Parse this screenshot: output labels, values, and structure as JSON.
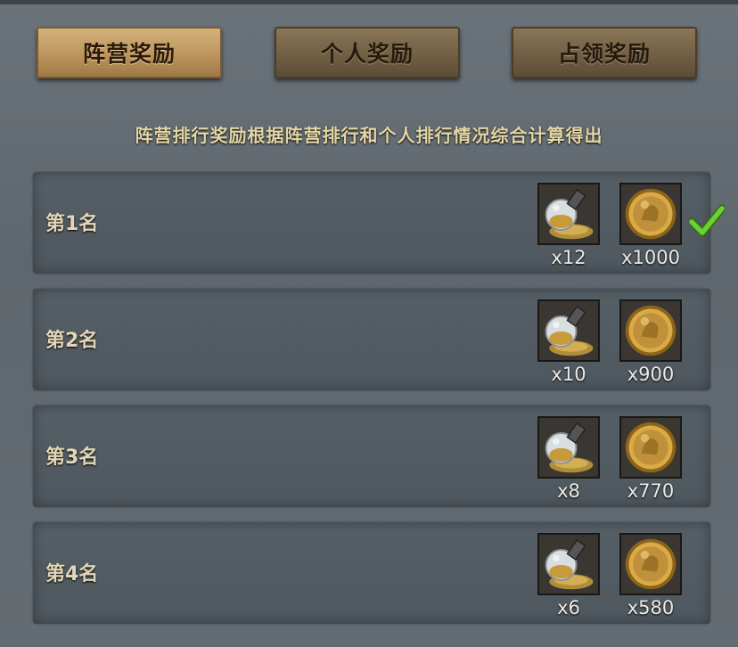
{
  "tabs": [
    {
      "label": "阵营奖励",
      "active": true
    },
    {
      "label": "个人奖励",
      "active": false
    },
    {
      "label": "占领奖励",
      "active": false
    }
  ],
  "subtitle": "阵营排行奖励根据阵营排行和个人排行情况综合计算得出",
  "rewards": [
    {
      "rank": "第1名",
      "items": [
        {
          "icon": "gold-dust-bottle-icon",
          "qty": "x12"
        },
        {
          "icon": "gold-coin-icon",
          "qty": "x1000"
        }
      ],
      "claimed": true
    },
    {
      "rank": "第2名",
      "items": [
        {
          "icon": "gold-dust-bottle-icon",
          "qty": "x10"
        },
        {
          "icon": "gold-coin-icon",
          "qty": "x900"
        }
      ],
      "claimed": false
    },
    {
      "rank": "第3名",
      "items": [
        {
          "icon": "gold-dust-bottle-icon",
          "qty": "x8"
        },
        {
          "icon": "gold-coin-icon",
          "qty": "x770"
        }
      ],
      "claimed": false
    },
    {
      "rank": "第4名",
      "items": [
        {
          "icon": "gold-dust-bottle-icon",
          "qty": "x6"
        },
        {
          "icon": "gold-coin-icon",
          "qty": "x580"
        }
      ],
      "claimed": false
    }
  ],
  "colors": {
    "accent": "#d6b57c",
    "subtitle": "#e3d6a4",
    "check": "#5fbf2c"
  }
}
